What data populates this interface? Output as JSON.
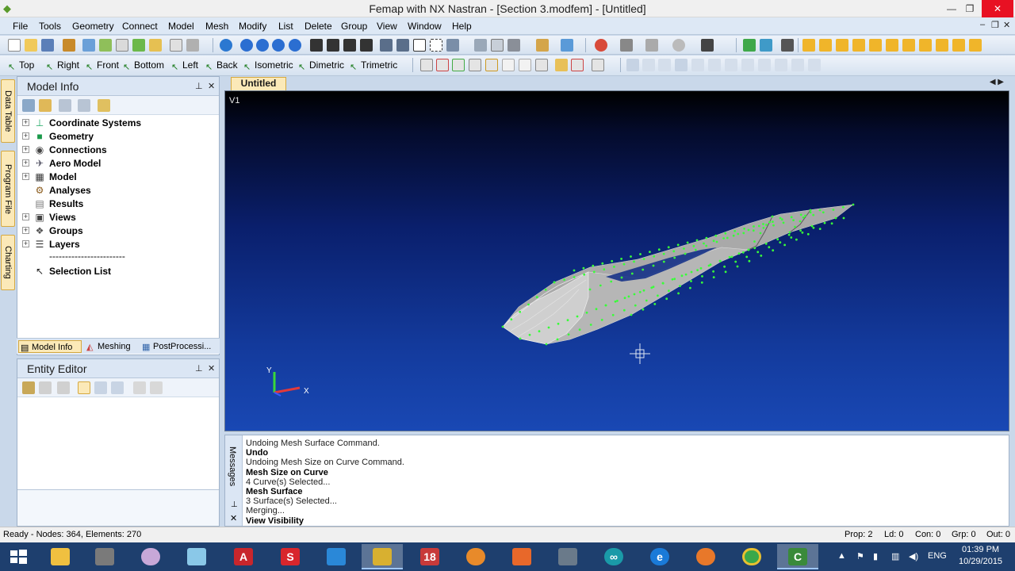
{
  "window": {
    "title": "Femap with NX Nastran - [Section 3.modfem] - [Untitled]"
  },
  "menu": [
    "File",
    "Tools",
    "Geometry",
    "Connect",
    "Model",
    "Mesh",
    "Modify",
    "List",
    "Delete",
    "Group",
    "View",
    "Window",
    "Help"
  ],
  "view_toolbar": [
    "Top",
    "Right",
    "Front",
    "Bottom",
    "Left",
    "Back",
    "Isometric",
    "Dimetric",
    "Trimetric"
  ],
  "side_tabs": [
    "Data Table",
    "Program File",
    "Charting"
  ],
  "model_info": {
    "title": "Model Info",
    "tree": [
      "Coordinate Systems",
      "Geometry",
      "Connections",
      "Aero Model",
      "Model",
      "Analyses",
      "Results",
      "Views",
      "Groups",
      "Layers"
    ],
    "divider": "------------------------",
    "selection_list": "Selection List"
  },
  "panel_tabs": [
    "Model Info",
    "Meshing",
    "PostProcessi..."
  ],
  "entity_editor": {
    "title": "Entity Editor"
  },
  "document": {
    "tab": "Untitled",
    "view_label": "V1"
  },
  "axis": {
    "x": "X",
    "y": "Y"
  },
  "messages": {
    "side_label": "Messages",
    "lines": [
      {
        "text": "Undoing Mesh Surface Command.",
        "bold": false
      },
      {
        "text": "Undo",
        "bold": true
      },
      {
        "text": "Undoing Mesh Size on Curve Command.",
        "bold": false
      },
      {
        "text": "Mesh Size on Curve",
        "bold": true
      },
      {
        "text": "4 Curve(s) Selected...",
        "bold": false
      },
      {
        "text": "Mesh Surface",
        "bold": true
      },
      {
        "text": "3 Surface(s) Selected...",
        "bold": false
      },
      {
        "text": "Merging...",
        "bold": false
      },
      {
        "text": "View Visibility",
        "bold": true
      }
    ]
  },
  "status": {
    "left": "Ready - Nodes: 364, Elements: 270",
    "prop": "Prop: 2",
    "ld": "Ld: 0",
    "con": "Con: 0",
    "grp": "Grp: 0",
    "out": "Out: 0"
  },
  "taskbar": {
    "tray_lang": "ENG",
    "time": "01:39 PM",
    "date": "10/29/2015",
    "apps": [
      "file-explorer",
      "calculator",
      "paint",
      "notes",
      "autocad",
      "solidworks",
      "design-app",
      "femap",
      "app-18",
      "chemistry-app",
      "matlab",
      "solver-app",
      "arduino",
      "internet-explorer",
      "firefox",
      "chrome",
      "camtasia"
    ]
  },
  "colors": {
    "mesh_node": "#39ff39",
    "mesh_fill": "#b9b9b9",
    "panel_accent": "#fbe9b8",
    "close_red": "#e81123",
    "taskbar": "#1e3f6e"
  }
}
